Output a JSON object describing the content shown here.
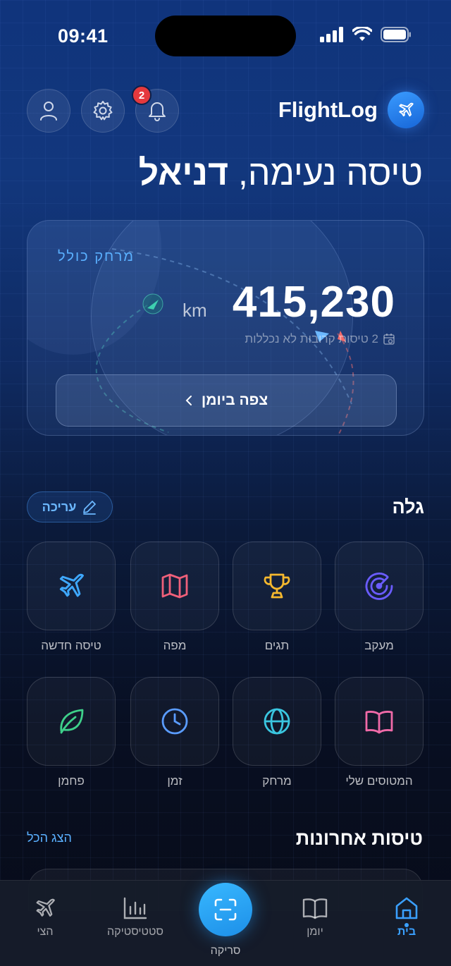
{
  "status_bar": {
    "time": "09:41"
  },
  "header": {
    "app_name": "FlightLog",
    "notification_count": "2",
    "greeting_prefix": "טיסה נעימה,",
    "user_name": "דניאל"
  },
  "distance_card": {
    "label": "מרחק כולל",
    "value": "415,230",
    "unit": "km",
    "note": "2 טיסות קרובות לא נכללות",
    "journal_button": "צפה ביומן"
  },
  "explore": {
    "title": "גלה",
    "edit_label": "עריכה",
    "tiles": [
      {
        "label": "מעקב",
        "icon": "radar-icon",
        "color": "#6a5cff"
      },
      {
        "label": "תגים",
        "icon": "trophy-icon",
        "color": "#f5b82e"
      },
      {
        "label": "מפה",
        "icon": "map-icon",
        "color": "#f0607a"
      },
      {
        "label": "טיסה חדשה",
        "icon": "plane-icon",
        "color": "#3ea8ff"
      },
      {
        "label": "המטוסים שלי",
        "icon": "book-icon",
        "color": "#f06aa8"
      },
      {
        "label": "מרחק",
        "icon": "globe-icon",
        "color": "#3ac6e0"
      },
      {
        "label": "זמן",
        "icon": "clock-icon",
        "color": "#5a9cff"
      },
      {
        "label": "פחמן",
        "icon": "leaf-icon",
        "color": "#3ed08a"
      }
    ]
  },
  "recent": {
    "title": "טיסות אחרונות",
    "show_all": "הצג הכל"
  },
  "tab_bar": {
    "home": "בית",
    "journal": "יומן",
    "scan": "סריקה",
    "stats": "סטטיסטיקה",
    "fleet": "הצי"
  }
}
